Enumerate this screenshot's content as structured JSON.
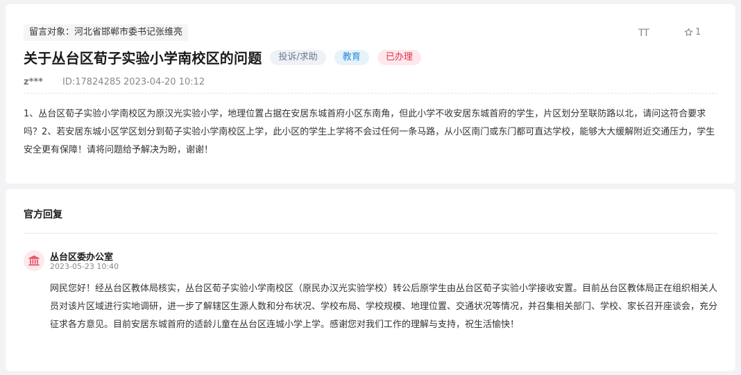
{
  "message": {
    "target": "留言对象：河北省邯郸市委书记张维亮",
    "title": "关于丛台区荀子实验小学南校区的问题",
    "tags": {
      "category": "投诉/求助",
      "field": "教育",
      "status": "已办理"
    },
    "font_toggle": "TT",
    "star_count": "1",
    "user": "z***",
    "id": "ID:17824285",
    "time": "2023-04-20 10:12",
    "content": "1、丛台区荀子实验小学南校区为原汉光实验小学，地理位置占据在安居东城首府小区东南角，但此小学不收安居东城首府的学生，片区划分至联防路以北，请问这符合要求吗？2、若安居东城小区学区划分到荀子实验小学南校区上学，此小区的学生上学将不会过任何一条马路，从小区南门或东门都可直达学校，能够大大缓解附近交通压力，学生安全更有保障！请将问题给予解决为盼，谢谢！"
  },
  "reply": {
    "section_title": "官方回复",
    "department": "丛台区委办公室",
    "time": "2023-05-23 10:40",
    "content": "网民您好！经丛台区教体局核实，丛台区荀子实验小学南校区（原民办汉光实验学校）转公后原学生由丛台区荀子实验小学接收安置。目前丛台区教体局正在组织相关人员对该片区域进行实地调研，进一步了解辖区生源人数和分布状况、学校布局、学校规模、地理位置、交通状况等情况，并召集相关部门、学校、家长召开座谈会，充分征求各方意见。目前安居东城首府的适龄儿童在丛台区连城小学上学。感谢您对我们工作的理解与支持，祝生活愉快！"
  },
  "icons": {
    "star": "star-outline-icon",
    "avatar": "government-building-icon",
    "font": "font-size-icon"
  },
  "colors": {
    "status_red": "#e0304e",
    "education_blue": "#2a8ad4",
    "background": "#f2f3f5"
  }
}
